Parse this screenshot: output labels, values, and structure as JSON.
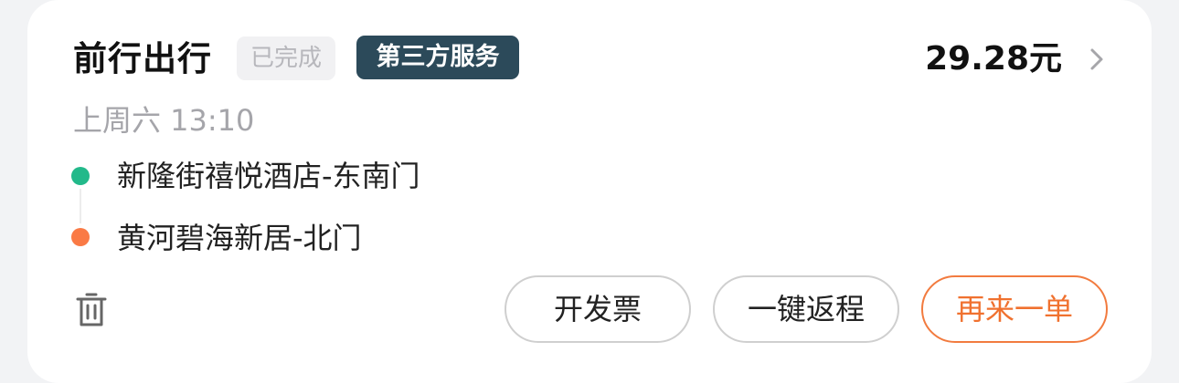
{
  "order": {
    "service_name": "前行出行",
    "status": "已完成",
    "provider_badge": "第三方服务",
    "price": "29.28元",
    "time": "上周六 13:10",
    "route": {
      "start": "新隆街禧悦酒店-东南门",
      "end": "黄河碧海新居-北门"
    }
  },
  "actions": {
    "invoice": "开发票",
    "return_trip": "一键返程",
    "reorder": "再来一单"
  },
  "icons": {
    "detail": "chevron-right-icon",
    "delete": "trash-icon"
  },
  "colors": {
    "start_dot": "#22b98a",
    "end_dot": "#fa7a45",
    "badge_bg": "#2c4a5a",
    "accent": "#f0712f"
  }
}
